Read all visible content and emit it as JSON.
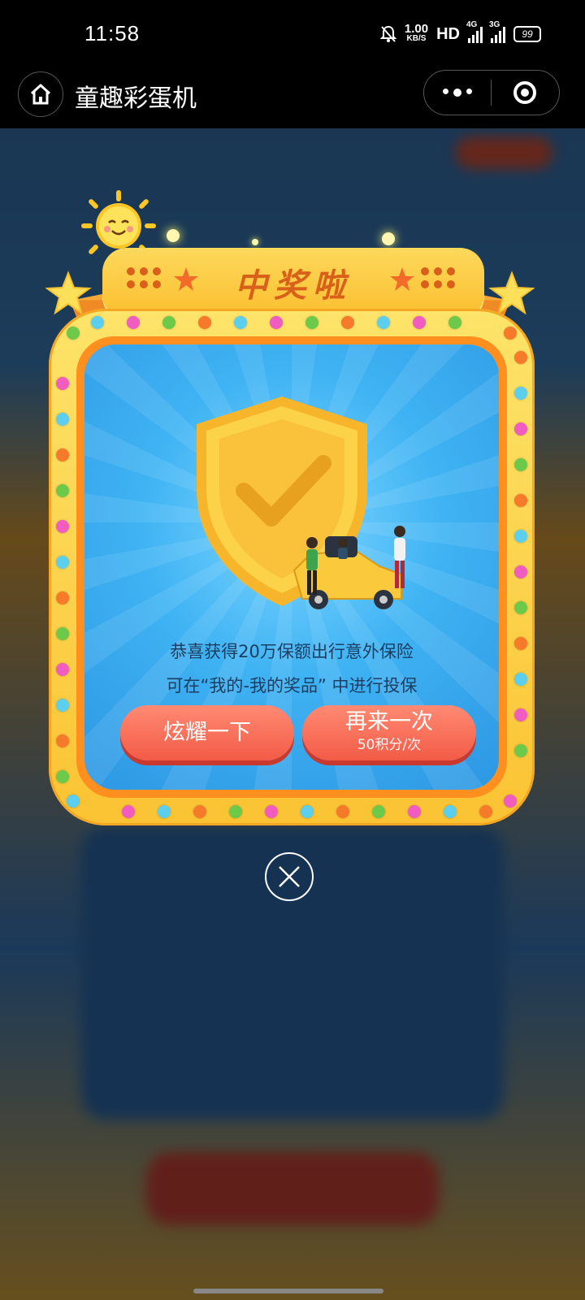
{
  "status_bar": {
    "time": "11:58",
    "net_speed_value": "1.00",
    "net_speed_unit": "KB/S",
    "hd_label": "HD",
    "signal1_label": "4G",
    "signal2_label": "3G",
    "battery": "99"
  },
  "nav": {
    "title": "童趣彩蛋机"
  },
  "modal": {
    "banner_title": "中奖啦",
    "message_line1": "恭喜获得20万保额出行意外保险",
    "message_line2": "可在“我的-我的奖品” 中进行投保",
    "show_off_button": "炫耀一下",
    "retry_button": "再来一次",
    "retry_cost": "50积分/次"
  },
  "colors": {
    "frame_yellow": "#fbc333",
    "frame_orange": "#ff8f1f",
    "panel_blue": "#3fb3f3",
    "button_red": "#f35b46",
    "banner_text": "#d9601a"
  },
  "icons": {
    "home": "home-icon",
    "more": "more-dots-icon",
    "close_capsule": "target-icon",
    "close_modal": "close-icon",
    "prize": "shield-check-icon"
  }
}
